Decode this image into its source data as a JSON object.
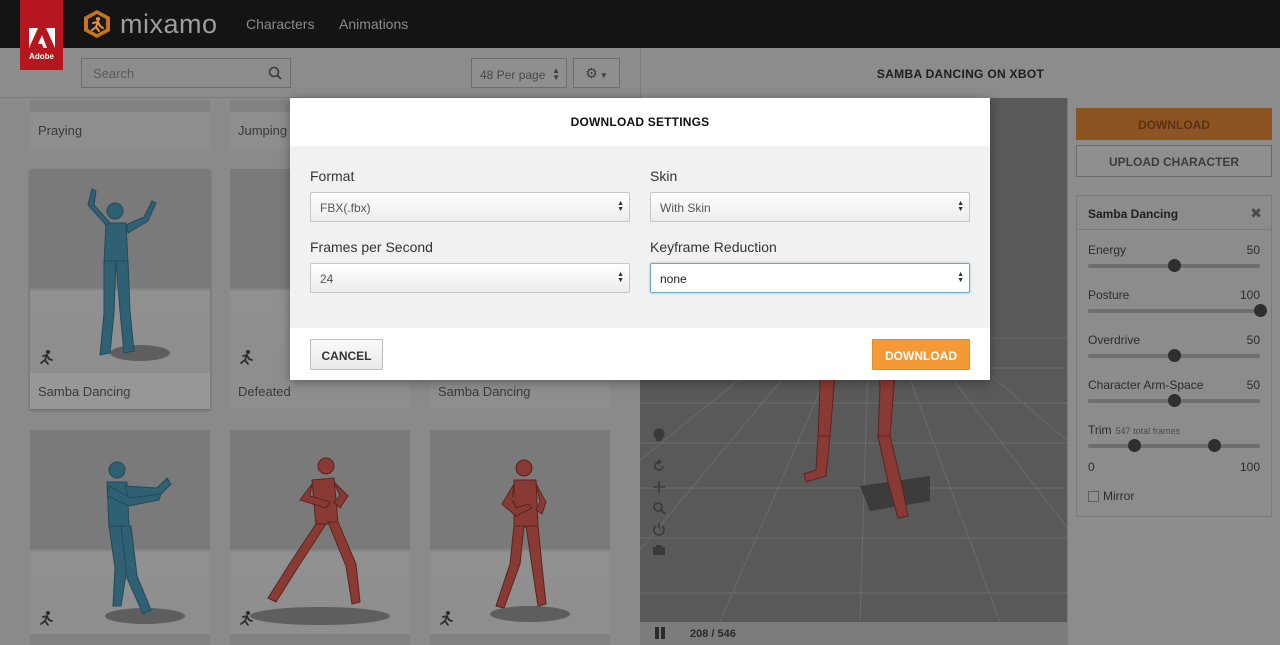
{
  "header": {
    "adobe_label": "Adobe",
    "logo_text": "mixamo",
    "nav": [
      "Characters",
      "Animations"
    ]
  },
  "browser": {
    "search_placeholder": "Search",
    "per_page": "48 Per page",
    "cards": [
      {
        "label": "Praying"
      },
      {
        "label": "Jumping"
      },
      {
        "label": "Samba Dancing"
      },
      {
        "label": "Defeated"
      },
      {
        "label": "Samba Dancing"
      },
      {
        "label": ""
      },
      {
        "label": ""
      },
      {
        "label": ""
      }
    ]
  },
  "viewer": {
    "title": "SAMBA DANCING ON XBOT",
    "frame_counter": "208 / 546"
  },
  "sidebar": {
    "download_label": "DOWNLOAD",
    "upload_label": "UPLOAD CHARACTER",
    "panel_title": "Samba Dancing",
    "params": [
      {
        "name": "Energy",
        "value": "50",
        "level": 0.5
      },
      {
        "name": "Posture",
        "value": "100",
        "level": 1.0
      },
      {
        "name": "Overdrive",
        "value": "50",
        "level": 0.5
      },
      {
        "name": "Character Arm-Space",
        "value": "50",
        "level": 0.5
      }
    ],
    "trim": {
      "label": "Trim",
      "sub": "547 total frames",
      "min": "0",
      "max": "100",
      "start": 0.27,
      "end": 0.73
    },
    "mirror_label": "Mirror"
  },
  "modal": {
    "title": "DOWNLOAD SETTINGS",
    "format_label": "Format",
    "format_value": "FBX(.fbx)",
    "skin_label": "Skin",
    "skin_value": "With Skin",
    "fps_label": "Frames per Second",
    "fps_value": "24",
    "keyframe_label": "Keyframe Reduction",
    "keyframe_value": "none",
    "cancel_label": "CANCEL",
    "download_label": "DOWNLOAD"
  },
  "colors": {
    "accent_orange": "#f39a37",
    "adobe_red": "#b6171e",
    "teal_character": "#2f6073",
    "red_character": "#8a3a34"
  }
}
